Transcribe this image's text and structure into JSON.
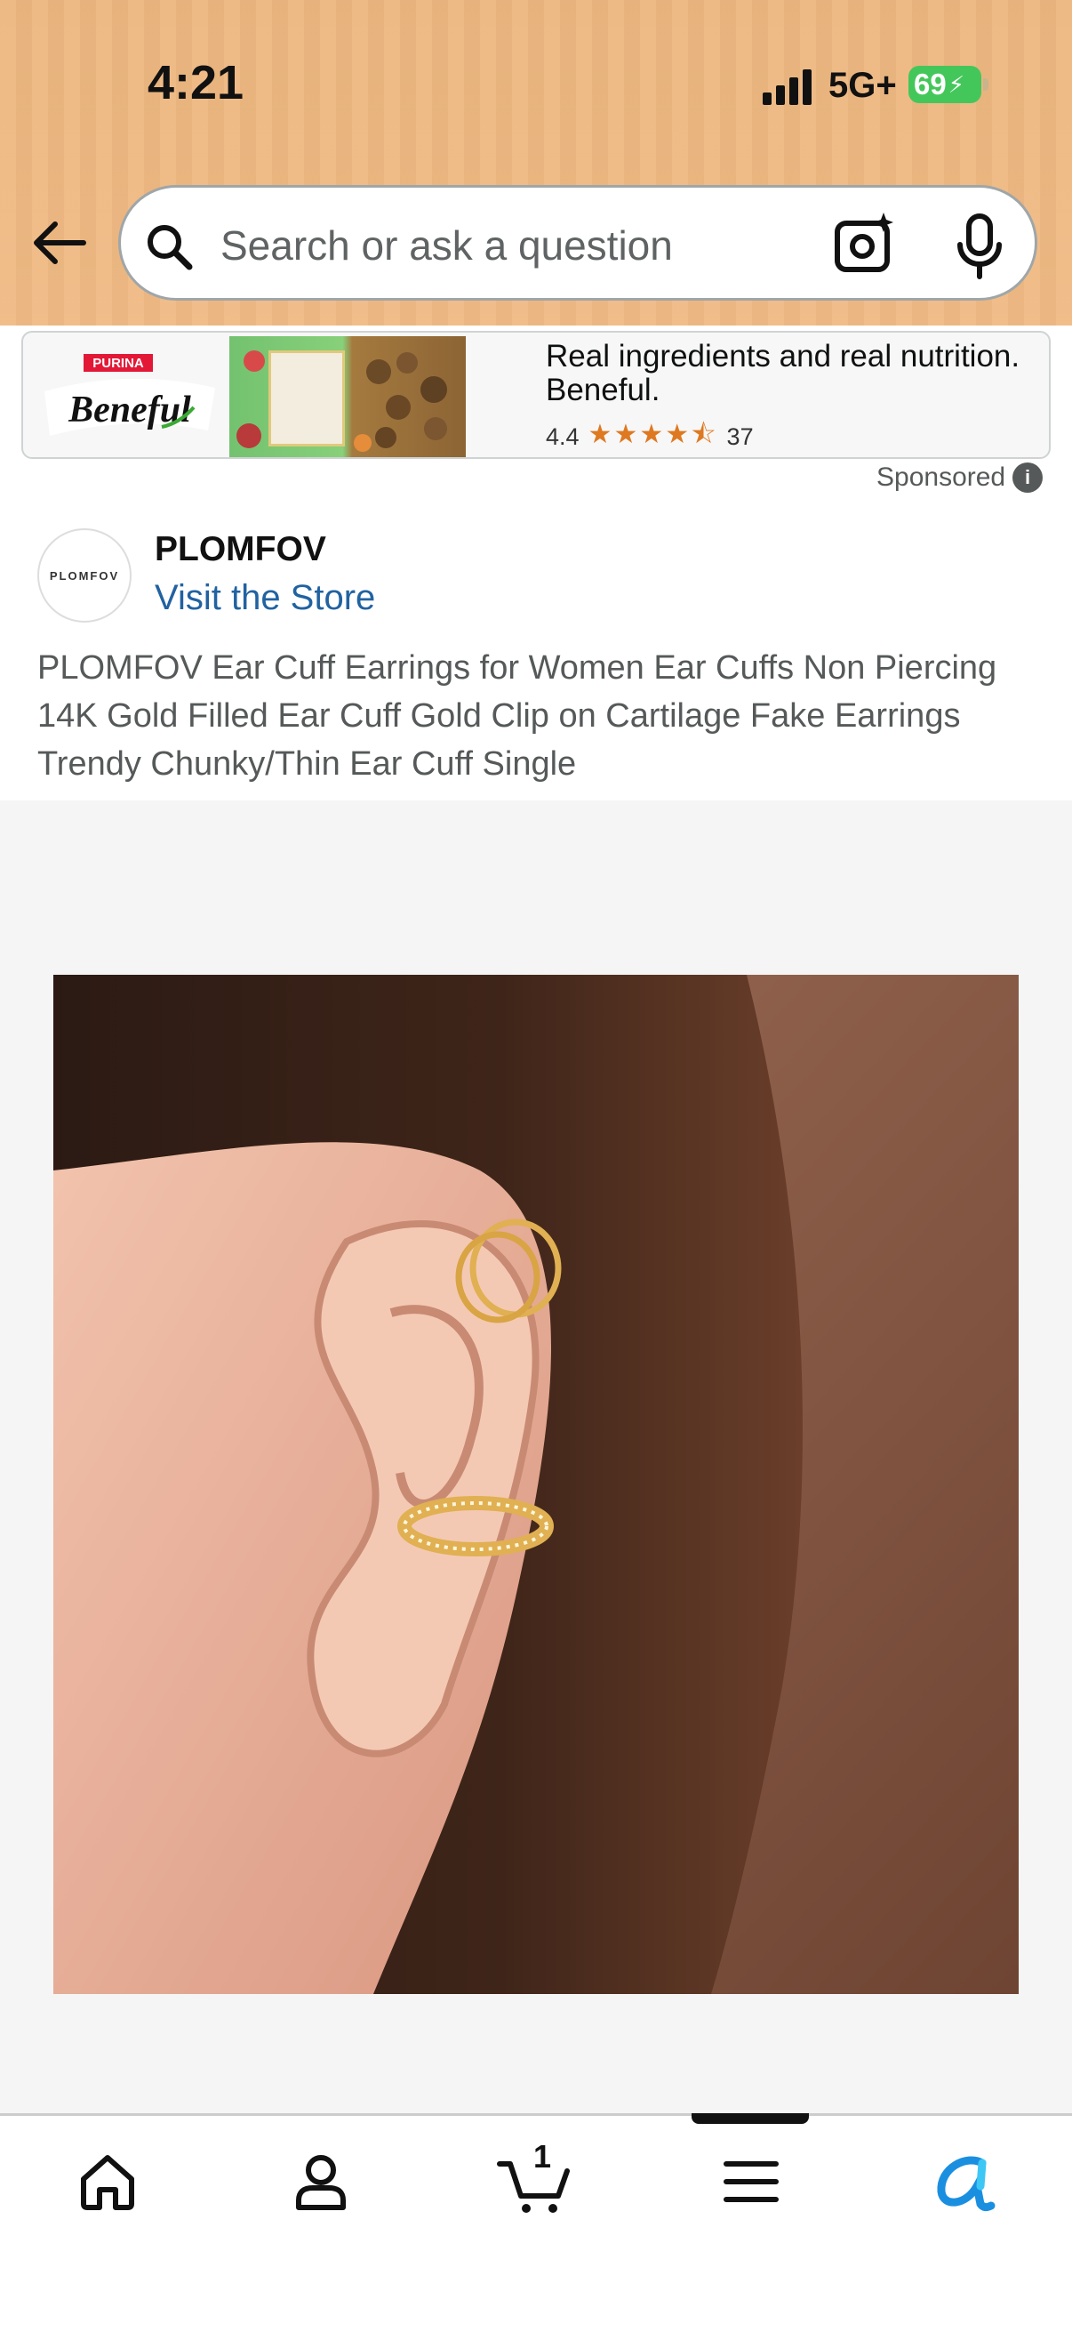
{
  "status_bar": {
    "time": "4:21",
    "network": "5G+",
    "battery": "69"
  },
  "search": {
    "placeholder": "Search or ask a question"
  },
  "ad": {
    "brand_top": "PURINA",
    "brand": "Beneful",
    "headline": "Real ingredients and real nutrition. Beneful.",
    "rating": "4.4",
    "stars": "★★★★⯪",
    "review_count": "37",
    "sponsored_label": "Sponsored"
  },
  "store": {
    "logo_text": "PLOMFOV",
    "brand": "PLOMFOV",
    "visit_link": "Visit the Store"
  },
  "product": {
    "title": "PLOMFOV Ear Cuff Earrings for Women Ear Cuffs Non Piercing 14K Gold Filled Ear Cuff Gold Clip on Cartilage Fake Earrings Trendy Chunky/Thin Ear Cuff Single"
  },
  "tabbar": {
    "cart_count": "1"
  },
  "colors": {
    "header": "#ecb67f",
    "link": "#2162a1",
    "star": "#de7921",
    "gold": "#e0b052"
  }
}
